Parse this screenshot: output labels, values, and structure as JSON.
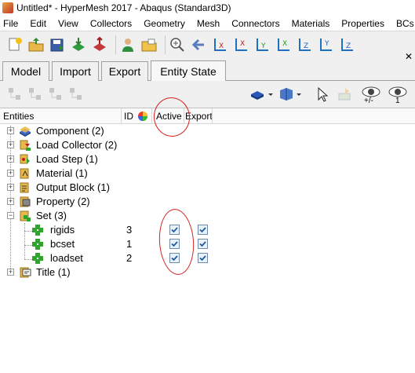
{
  "window": {
    "title": "Untitled* - HyperMesh 2017 - Abaqus (Standard3D)"
  },
  "menu": [
    "File",
    "Edit",
    "View",
    "Collectors",
    "Geometry",
    "Mesh",
    "Connectors",
    "Materials",
    "Properties",
    "BCs"
  ],
  "tabs": [
    {
      "label": "Model",
      "active": false
    },
    {
      "label": "Import",
      "active": false
    },
    {
      "label": "Export",
      "active": false
    },
    {
      "label": "Entity State",
      "active": true
    }
  ],
  "subtoolbar": {
    "show_hide_label": "+/-",
    "count_label": "1"
  },
  "columns": {
    "entities": "Entities",
    "id": "ID",
    "active": "Active",
    "export": "Export"
  },
  "tree": [
    {
      "label": "Component (2)",
      "icon": "component-icon",
      "expanded": false
    },
    {
      "label": "Load Collector (2)",
      "icon": "load-collector-icon",
      "expanded": false
    },
    {
      "label": "Load Step (1)",
      "icon": "load-step-icon",
      "expanded": false
    },
    {
      "label": "Material (1)",
      "icon": "material-icon",
      "expanded": false
    },
    {
      "label": "Output Block (1)",
      "icon": "output-block-icon",
      "expanded": false
    },
    {
      "label": "Property (2)",
      "icon": "property-icon",
      "expanded": false
    },
    {
      "label": "Set (3)",
      "icon": "set-icon",
      "expanded": true,
      "children": [
        {
          "label": "rigids",
          "id": "3",
          "active": true,
          "export": true
        },
        {
          "label": "bcset",
          "id": "1",
          "active": true,
          "export": true
        },
        {
          "label": "loadset",
          "id": "2",
          "active": true,
          "export": true
        }
      ]
    },
    {
      "label": "Title (1)",
      "icon": "title-icon",
      "expanded": false
    }
  ],
  "colors": {
    "annotation": "#d62020",
    "check": "#1e5aa0",
    "set_green": "#2fa52f"
  }
}
